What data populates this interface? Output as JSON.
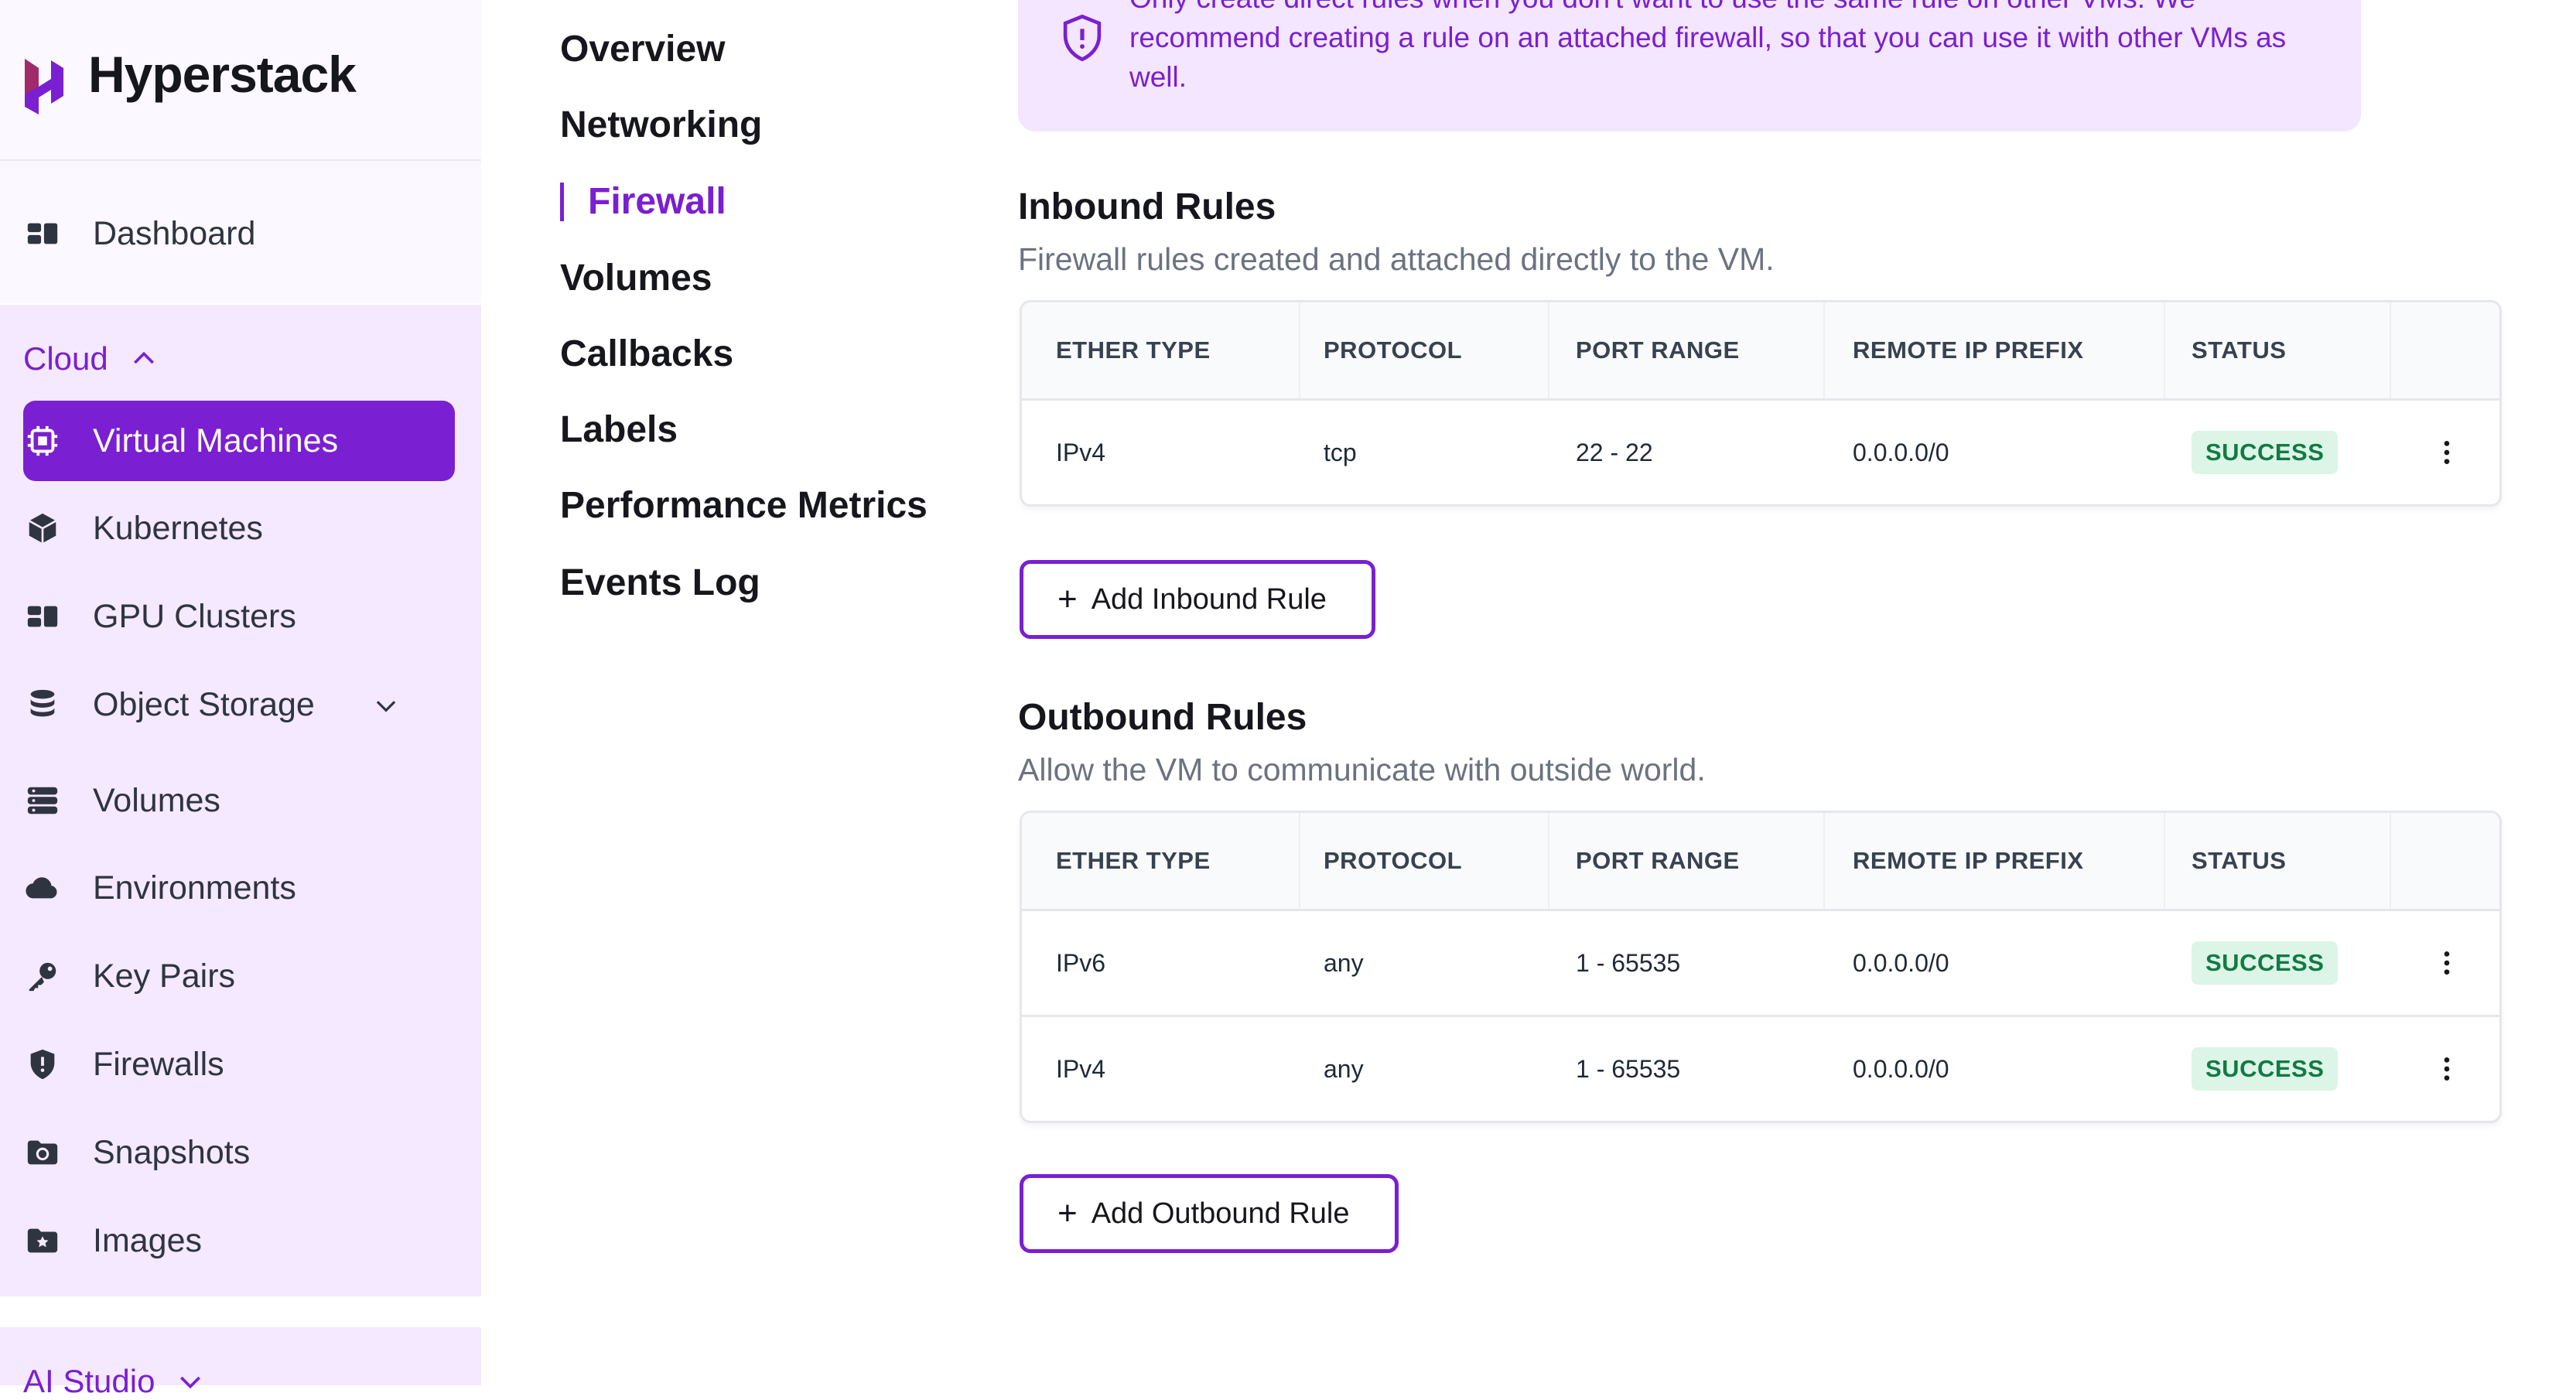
{
  "brand": {
    "name": "Hyperstack",
    "color": "#7a1fd1"
  },
  "sidebar": {
    "dashboard": {
      "label": "Dashboard",
      "icon": "dashboard-icon"
    },
    "cloud_group": {
      "label": "Cloud",
      "expanded": true
    },
    "items": [
      {
        "label": "Virtual Machines",
        "icon": "chip-icon",
        "active": true
      },
      {
        "label": "Kubernetes",
        "icon": "cube-icon"
      },
      {
        "label": "GPU Clusters",
        "icon": "dashboard-icon"
      },
      {
        "label": "Object Storage",
        "icon": "database-icon",
        "has_submenu": true
      },
      {
        "label": "Volumes",
        "icon": "server-icon"
      },
      {
        "label": "Environments",
        "icon": "cloud-icon"
      },
      {
        "label": "Key Pairs",
        "icon": "key-icon"
      },
      {
        "label": "Firewalls",
        "icon": "shield-icon"
      },
      {
        "label": "Snapshots",
        "icon": "folder-snapshot-icon"
      },
      {
        "label": "Images",
        "icon": "folder-star-icon"
      }
    ],
    "ai_group": {
      "label": "AI Studio"
    }
  },
  "subnav": [
    {
      "label": "Overview"
    },
    {
      "label": "Networking"
    },
    {
      "label": "Firewall",
      "active": true
    },
    {
      "label": "Volumes"
    },
    {
      "label": "Callbacks"
    },
    {
      "label": "Labels"
    },
    {
      "label": "Performance Metrics"
    },
    {
      "label": "Events Log"
    }
  ],
  "alert": {
    "icon": "shield-alert-icon",
    "text": "Only create direct rules when you don't want to use the same rule on other VMs. We recommend creating a rule on an attached firewall, so that you can use it with other VMs as well."
  },
  "inbound": {
    "title": "Inbound Rules",
    "subtitle": "Firewall rules created and attached directly to the VM.",
    "columns": [
      "ETHER TYPE",
      "PROTOCOL",
      "PORT RANGE",
      "REMOTE IP PREFIX",
      "STATUS"
    ],
    "rows": [
      {
        "ether_type": "IPv4",
        "protocol": "tcp",
        "port_range": "22 - 22",
        "remote_ip_prefix": "0.0.0.0/0",
        "status": "SUCCESS"
      }
    ],
    "add_button": "Add Inbound Rule"
  },
  "outbound": {
    "title": "Outbound Rules",
    "subtitle": "Allow the VM to communicate with outside world.",
    "columns": [
      "ETHER TYPE",
      "PROTOCOL",
      "PORT RANGE",
      "REMOTE IP PREFIX",
      "STATUS"
    ],
    "rows": [
      {
        "ether_type": "IPv6",
        "protocol": "any",
        "port_range": "1 - 65535",
        "remote_ip_prefix": "0.0.0.0/0",
        "status": "SUCCESS"
      },
      {
        "ether_type": "IPv4",
        "protocol": "any",
        "port_range": "1 - 65535",
        "remote_ip_prefix": "0.0.0.0/0",
        "status": "SUCCESS"
      }
    ],
    "add_button": "Add Outbound Rule"
  }
}
